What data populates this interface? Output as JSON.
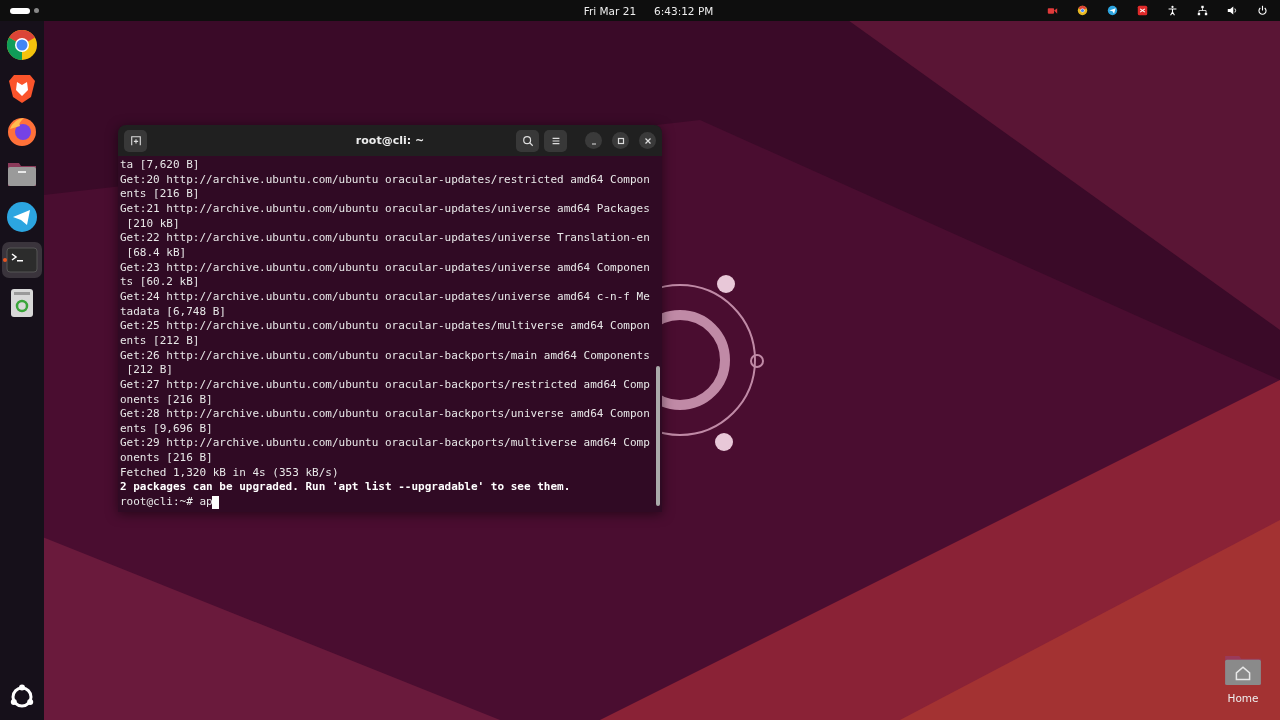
{
  "top_bar": {
    "date": "Fri Mar 21",
    "time": "6:43:12 PM"
  },
  "dock": {
    "items": [
      {
        "kind": "chrome",
        "running": false
      },
      {
        "kind": "brave",
        "running": false
      },
      {
        "kind": "firefox",
        "running": false
      },
      {
        "kind": "files",
        "running": false
      },
      {
        "kind": "telegram",
        "running": false
      },
      {
        "kind": "terminal",
        "running": true
      },
      {
        "kind": "trash",
        "running": false
      }
    ]
  },
  "terminal": {
    "title": "root@cli: ~",
    "lines": [
      {
        "text": "ta [7,620 B]",
        "kind": "normal"
      },
      {
        "text": "Get:20 http://archive.ubuntu.com/ubuntu oracular-updates/restricted amd64 Compon",
        "kind": "normal"
      },
      {
        "text": "ents [216 B]",
        "kind": "normal"
      },
      {
        "text": "Get:21 http://archive.ubuntu.com/ubuntu oracular-updates/universe amd64 Packages",
        "kind": "normal"
      },
      {
        "text": " [210 kB]",
        "kind": "normal"
      },
      {
        "text": "Get:22 http://archive.ubuntu.com/ubuntu oracular-updates/universe Translation-en",
        "kind": "normal"
      },
      {
        "text": " [68.4 kB]",
        "kind": "normal"
      },
      {
        "text": "Get:23 http://archive.ubuntu.com/ubuntu oracular-updates/universe amd64 Componen",
        "kind": "normal"
      },
      {
        "text": "ts [60.2 kB]",
        "kind": "normal"
      },
      {
        "text": "Get:24 http://archive.ubuntu.com/ubuntu oracular-updates/universe amd64 c-n-f Me",
        "kind": "normal"
      },
      {
        "text": "tadata [6,748 B]",
        "kind": "normal"
      },
      {
        "text": "Get:25 http://archive.ubuntu.com/ubuntu oracular-updates/multiverse amd64 Compon",
        "kind": "normal"
      },
      {
        "text": "ents [212 B]",
        "kind": "normal"
      },
      {
        "text": "Get:26 http://archive.ubuntu.com/ubuntu oracular-backports/main amd64 Components",
        "kind": "normal"
      },
      {
        "text": " [212 B]",
        "kind": "normal"
      },
      {
        "text": "Get:27 http://archive.ubuntu.com/ubuntu oracular-backports/restricted amd64 Comp",
        "kind": "normal"
      },
      {
        "text": "onents [216 B]",
        "kind": "normal"
      },
      {
        "text": "Get:28 http://archive.ubuntu.com/ubuntu oracular-backports/universe amd64 Compon",
        "kind": "normal"
      },
      {
        "text": "ents [9,696 B]",
        "kind": "normal"
      },
      {
        "text": "Get:29 http://archive.ubuntu.com/ubuntu oracular-backports/multiverse amd64 Comp",
        "kind": "normal"
      },
      {
        "text": "onents [216 B]",
        "kind": "normal"
      },
      {
        "text": "Fetched 1,320 kB in 4s (353 kB/s)",
        "kind": "normal"
      },
      {
        "text": "2 packages can be upgraded. Run 'apt list --upgradable' to see them.",
        "kind": "bold"
      }
    ],
    "prompt": "root@cli:~# ap"
  },
  "desktop_icons": [
    {
      "label": "Home"
    }
  ]
}
